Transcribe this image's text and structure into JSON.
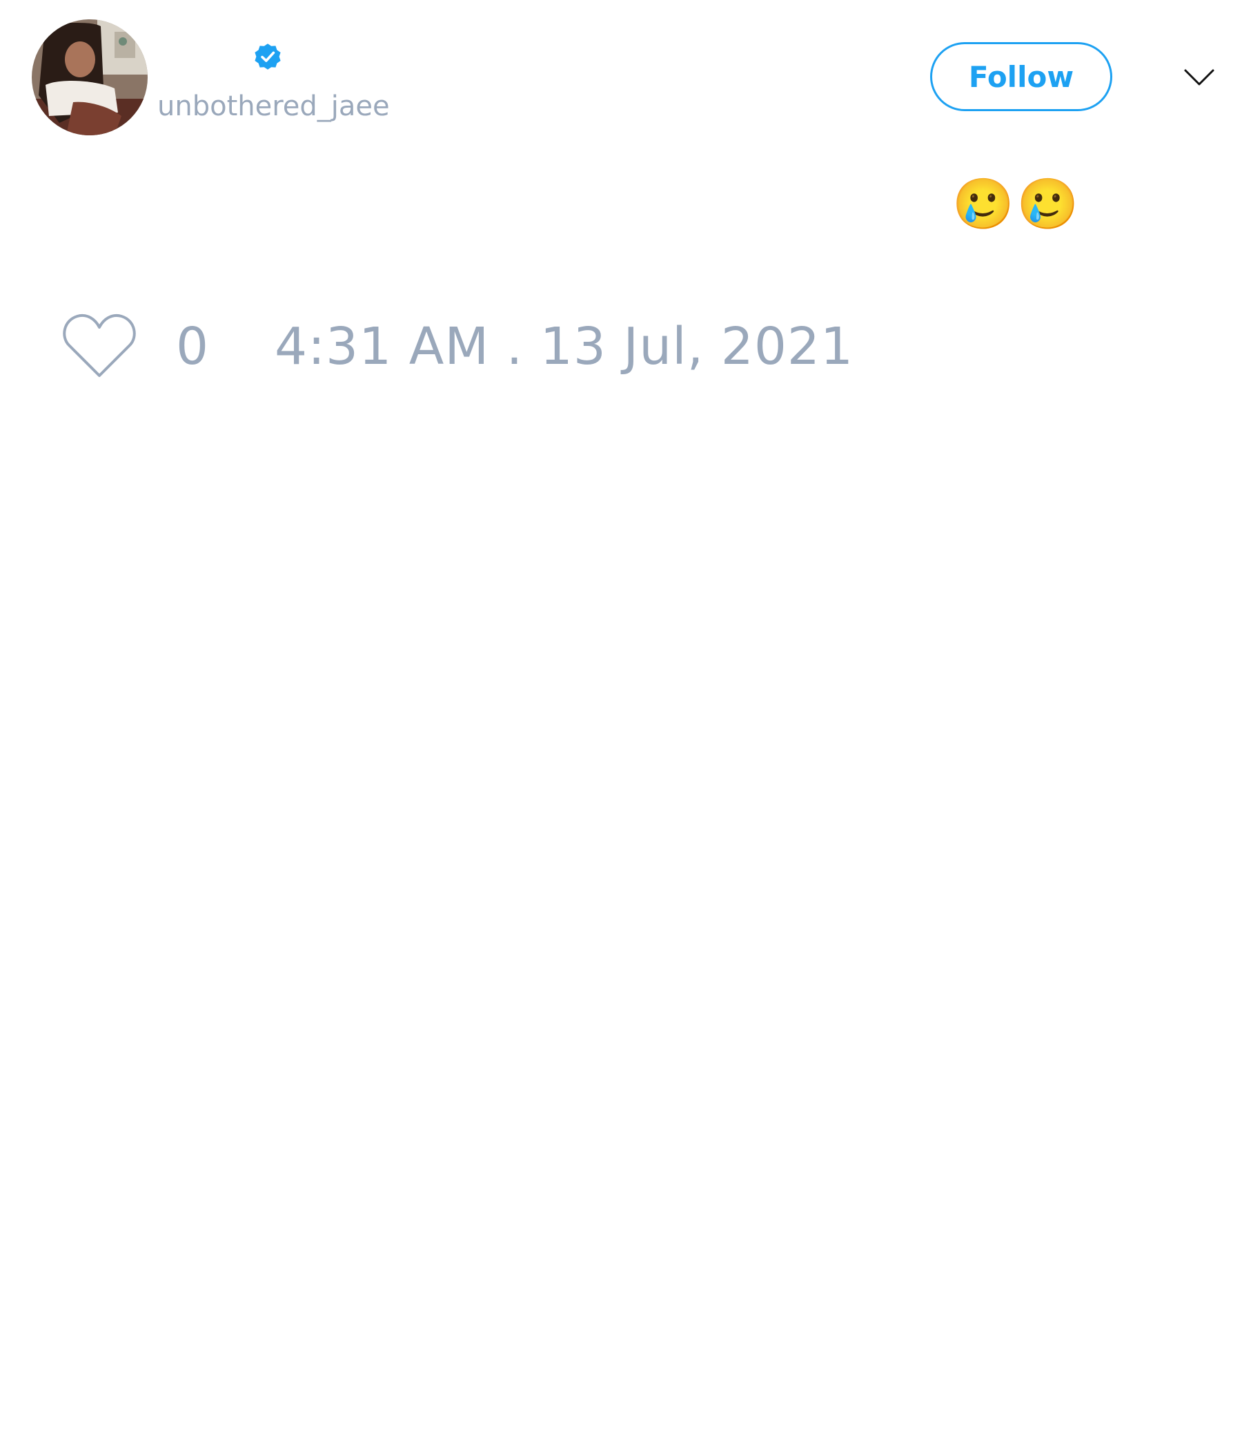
{
  "tweet": {
    "user": {
      "display_name": "",
      "handle": "unbothered_jaee",
      "verified": true,
      "avatar_icon": "profile-photo"
    },
    "follow_label": "Follow",
    "menu_icon": "chevron-down-icon",
    "text": "🥲🥲",
    "likes": "0",
    "like_icon": "heart-outline-icon",
    "timestamp": "4:31 AM . 13 Jul, 2021"
  },
  "colors": {
    "accent": "#1da1f2",
    "muted": "#9aa8bb",
    "background": "#ffffff"
  }
}
